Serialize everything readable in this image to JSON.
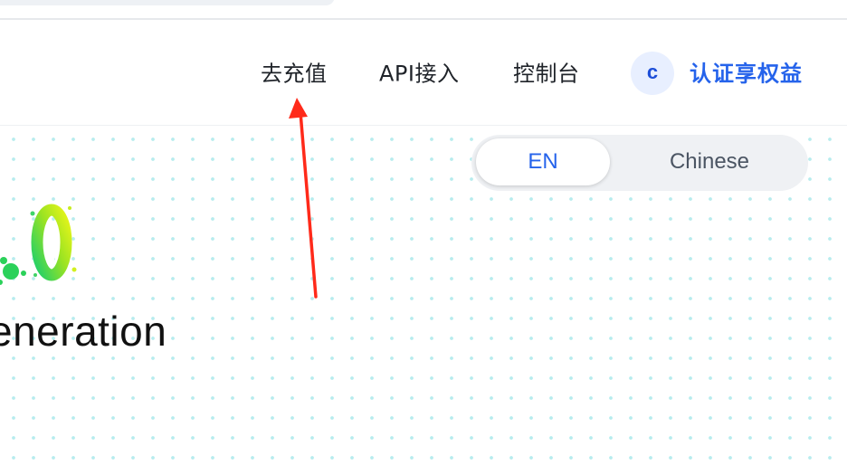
{
  "nav": {
    "recharge": "去充值",
    "api": "API接入",
    "console": "控制台",
    "avatar_letter": "c",
    "certify": "认证享权益"
  },
  "language_toggle": {
    "selected": "EN",
    "options": [
      "EN",
      "Chinese"
    ]
  },
  "hero": {
    "partial_title": "eneration"
  },
  "colors": {
    "accent": "#2563eb",
    "dots": "#b7ecee",
    "annotation": "#ff2a1a"
  }
}
